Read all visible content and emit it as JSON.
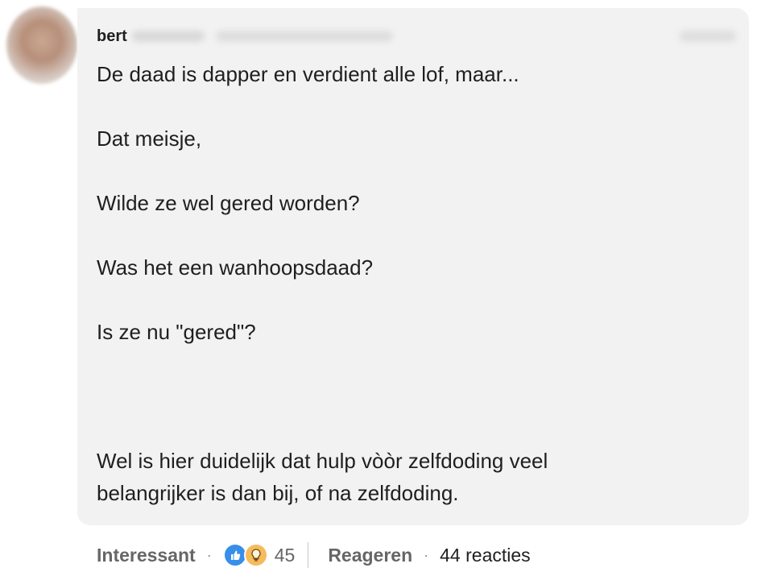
{
  "comment": {
    "author": "bert",
    "lines": [
      "De daad is dapper en verdient alle lof, maar...",
      "Dat meisje,",
      "Wilde ze wel gered worden?",
      "Was het een wanhoopsdaad?",
      "Is ze nu \"gered\"?",
      "Wel is hier duidelijk dat hulp vòòr zelfdoding veel",
      "belangrijker is dan bij, of na zelfdoding."
    ]
  },
  "actions": {
    "react_label": "Interessant",
    "reaction_count": "45",
    "reply_label": "Reageren",
    "replies_label": "44 reacties",
    "separator": "·"
  },
  "icons": {
    "like": "like-thumbs-up-icon",
    "insight": "insightful-lightbulb-icon"
  },
  "colors": {
    "bubble_bg": "#f2f2f2",
    "like_blue": "#378fe9",
    "insight_yellow": "#f5bb5c"
  }
}
